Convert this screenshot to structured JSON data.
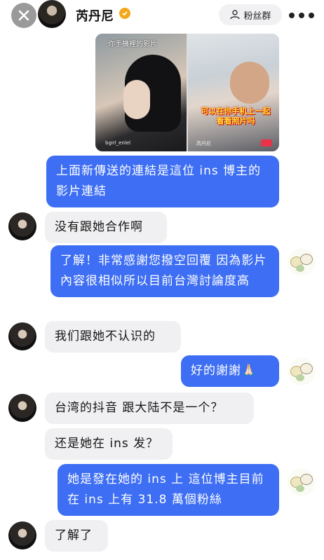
{
  "header": {
    "name": "芮丹尼",
    "fans_label": "粉丝群"
  },
  "video": {
    "left_caption": "你手機裡的影片",
    "left_user": "bgirl_enlel",
    "right_caption": "可以在你手机上一起看看照片吗",
    "right_user": "芮丹尼"
  },
  "messages": [
    {
      "side": "out",
      "text": "上面新傳送的連結是這位 ins 博主的影片連結"
    },
    {
      "side": "in",
      "text": "没有跟她合作啊"
    },
    {
      "side": "out",
      "text": "了解！非常感謝您撥空回覆 因為影片內容很相似所以目前台灣討論度高"
    },
    {
      "side": "in",
      "text": "我们跟她不认识的"
    },
    {
      "side": "out",
      "text": "好的謝謝🙏🏻"
    },
    {
      "side": "in",
      "text": "台湾的抖音 跟大陆不是一个？"
    },
    {
      "side": "in",
      "text": "还是她在 ins 发？"
    },
    {
      "side": "out",
      "text": "她是發在她的 ins 上 這位博主目前在 ins 上有 31.8 萬個粉絲"
    },
    {
      "side": "in",
      "text": "了解了"
    }
  ],
  "colors": {
    "outgoing_bubble": "#3d6ef3",
    "incoming_bubble": "#f0f0f2",
    "verified_badge": "#f2a818"
  }
}
